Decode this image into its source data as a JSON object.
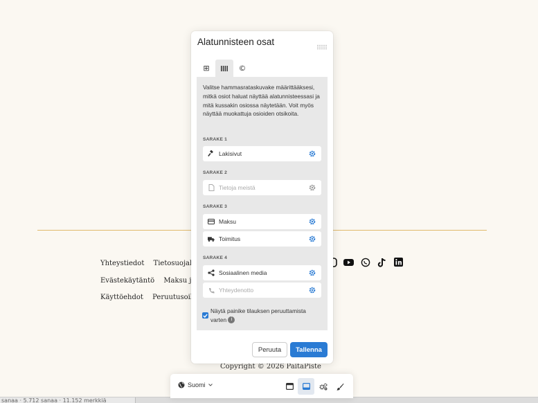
{
  "page": {
    "footer_links_row1": [
      "Yhteystiedot",
      "Tietosuojakäyt"
    ],
    "footer_links_row2": [
      "Evästekäytäntö",
      "Maksu ja toi"
    ],
    "footer_links_row3": [
      "Käyttöehdot",
      "Peruutusoikeus"
    ],
    "social_icons": [
      "instagram-icon",
      "youtube-icon",
      "whatsapp-icon",
      "tiktok-icon",
      "linkedin-icon"
    ],
    "copyright": "Copyright © 2026 PaitaPiste",
    "status_text": "sanaa  ·  5.712 sanaa  ·  11.152 merkkiä",
    "accent_color": "#e0b96c"
  },
  "modal": {
    "title": "Alatunnisteen osat",
    "tabs": [
      {
        "icon": "layout-grid-icon",
        "glyph": "⊞"
      },
      {
        "icon": "columns-icon",
        "glyph": "⦀"
      },
      {
        "icon": "copyright-icon",
        "glyph": "©"
      }
    ],
    "intro": "Valitse hammasrataskuvake määrittääksesi, mitkä osiot haluat näyttää alatunnisteessasi ja mitä kussakin osiossa näytetään. Voit myös näyttää muokattuja osioiden otsikoita.",
    "columns": [
      {
        "label": "SARAKE 1",
        "items": [
          {
            "label": "Lakisivut",
            "icon": "gavel-icon",
            "muted": false
          }
        ]
      },
      {
        "label": "SARAKE 2",
        "items": [
          {
            "label": "Tietoja meistä",
            "icon": "document-icon",
            "muted": true
          }
        ]
      },
      {
        "label": "SARAKE 3",
        "items": [
          {
            "label": "Maksu",
            "icon": "credit-card-icon",
            "muted": false
          },
          {
            "label": "Toimitus",
            "icon": "truck-icon",
            "muted": false
          }
        ]
      },
      {
        "label": "SARAKE 4",
        "items": [
          {
            "label": "Sosiaalinen media",
            "icon": "share-icon",
            "muted": false
          },
          {
            "label": "Yhteydenotto",
            "icon": "phone-icon",
            "muted": true
          }
        ]
      }
    ],
    "checkbox_label": "Näytä painike tilauksen peruuttamista varten",
    "checkbox_checked": true,
    "cancel_label": "Peruuta",
    "save_label": "Tallenna",
    "primary_color": "#2a7bd4"
  },
  "toolbar": {
    "language": "Suomi",
    "buttons": [
      "header-layout-icon",
      "footer-layout-icon",
      "settings-icon",
      "brush-icon"
    ],
    "active_button": "footer-layout-icon"
  }
}
